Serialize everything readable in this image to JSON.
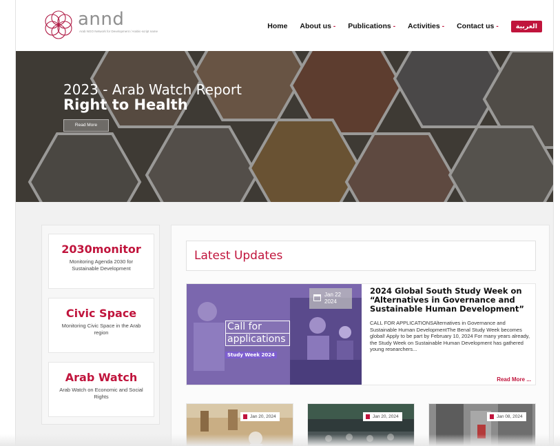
{
  "header": {
    "logo": {
      "word": "annd",
      "subtitle": "Arab NGO Network for Development / Arabic-script name"
    },
    "nav": [
      {
        "label": "Home",
        "dropdown": false
      },
      {
        "label": "About us",
        "dropdown": true
      },
      {
        "label": "Publications",
        "dropdown": true
      },
      {
        "label": "Activities",
        "dropdown": true
      },
      {
        "label": "Contact us",
        "dropdown": true
      }
    ],
    "language_button": "العربية",
    "dropdown_caret": "-"
  },
  "hero": {
    "title_line1": "2023 - Arab Watch Report",
    "title_line2": "Right to Health",
    "button": "Read More"
  },
  "sidebar": {
    "cards": [
      {
        "title": "2030monitor",
        "description": "Monitoring Agenda 2030 for Sustainable Development"
      },
      {
        "title": "Civic Space",
        "description": "Monitoring Civic Space in the Arab region"
      },
      {
        "title": "Arab Watch",
        "description": "Arab Watch on Economic and Social Rights"
      }
    ]
  },
  "latest": {
    "heading": "Latest Updates",
    "featured": {
      "date_line1": "Jan 22",
      "date_line2": "2024",
      "image_text": {
        "line1": "Call for",
        "line2": "applications",
        "tag": "Study Week 2024"
      },
      "title": "2024 Global South Study Week on “Alternatives in Governance and Sustainable Human Development”",
      "excerpt": "CALL FOR APPLICATIONSAlternatives in Governance and Sustainable Human DevelopmentThe Benal Study Week becomes global! Apply to be part by February 10, 2024 For many years already, the Study Week on Sustainable Human Development has gathered young researchers...",
      "read_more": "Read More ..."
    },
    "cards": [
      {
        "date": "Jan 20, 2024"
      },
      {
        "date": "Jan 20, 2024"
      },
      {
        "date": "Jan 08, 2024"
      }
    ]
  },
  "colors": {
    "accent": "#c0143c",
    "background": "#f1f1f1",
    "hero_overlay": "#3c3833"
  }
}
